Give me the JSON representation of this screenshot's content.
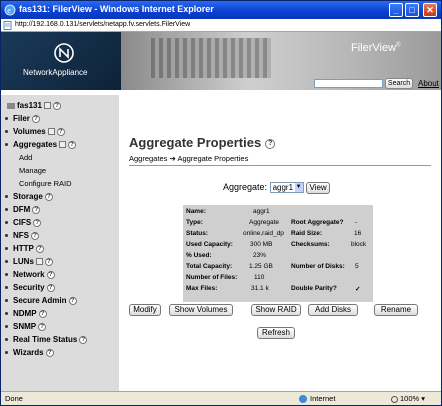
{
  "window": {
    "title": "fas131: FilerView - Windows Internet Explorer"
  },
  "address": {
    "url": "http://192.168.0.131/servlets/netapp.fv.servlets.FilerView"
  },
  "banner": {
    "logo_text": "NetworkAppliance",
    "product": "FilerView",
    "registered": "®"
  },
  "search": {
    "button_label": "Search",
    "about_label": "About"
  },
  "sidebar": {
    "hostname": "fas131",
    "items": [
      {
        "label": "Filer"
      },
      {
        "label": "Volumes"
      },
      {
        "label": "Aggregates"
      },
      {
        "label": "Storage"
      },
      {
        "label": "DFM"
      },
      {
        "label": "CIFS"
      },
      {
        "label": "NFS"
      },
      {
        "label": "HTTP"
      },
      {
        "label": "LUNs"
      },
      {
        "label": "Network"
      },
      {
        "label": "Security"
      },
      {
        "label": "Secure Admin"
      },
      {
        "label": "NDMP"
      },
      {
        "label": "SNMP"
      },
      {
        "label": "Real Time Status"
      },
      {
        "label": "Wizards"
      }
    ],
    "aggregates_sub": [
      "Add",
      "Manage",
      "Configure RAID"
    ]
  },
  "content": {
    "title": "Aggregate Properties",
    "breadcrumb": {
      "parent": "Aggregates",
      "arrow": "➔",
      "current": "Aggregate Properties"
    },
    "aggregate_label": "Aggregate:",
    "aggregate_selected": "aggr1",
    "view_button": "View",
    "properties_left": [
      {
        "label": "Name:",
        "value": "aggr1"
      },
      {
        "label": "Type:",
        "value": "Aggregate"
      },
      {
        "label": "Status:",
        "value": "online,raid_dp"
      },
      {
        "label": "Used Capacity:",
        "value": "300 MB"
      },
      {
        "label": "% Used:",
        "value": "23%"
      },
      {
        "label": "Total Capacity:",
        "value": "1.25 GB"
      },
      {
        "label": "Number of Files:",
        "value": "110"
      },
      {
        "label": "Max Files:",
        "value": "31.1 k"
      }
    ],
    "properties_right": [
      {
        "label": "Root Aggregate?",
        "value": "-"
      },
      {
        "label": "Raid Size:",
        "value": "16"
      },
      {
        "label": "Checksums:",
        "value": "block"
      },
      {
        "label": "Number of Disks:",
        "value": "5"
      },
      {
        "label": "Double Parity?",
        "value": "✓"
      }
    ],
    "actions": [
      "Modify",
      "Show Volumes",
      "Show RAID",
      "Add Disks",
      "Rename"
    ],
    "refresh_button": "Refresh"
  },
  "statusbar": {
    "left": "Done",
    "zone": "Internet",
    "zoom": "100%"
  }
}
